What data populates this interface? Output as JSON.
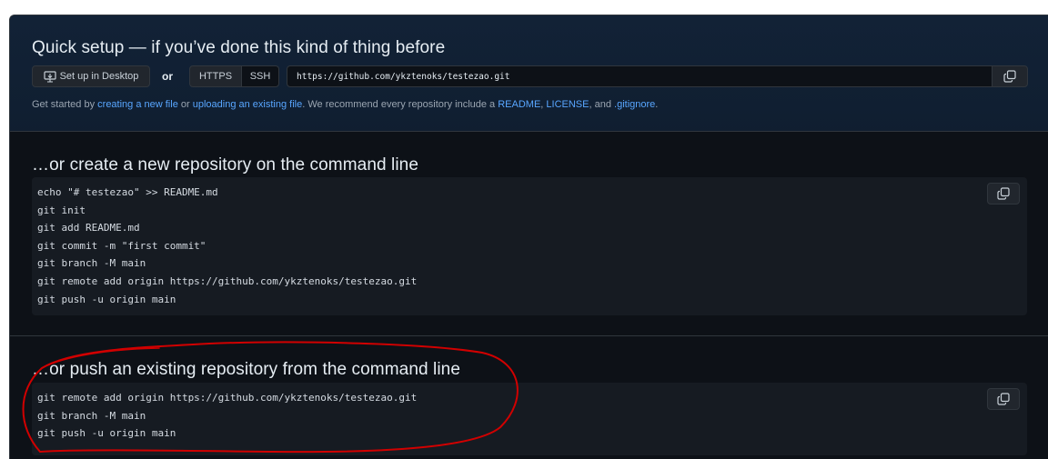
{
  "quick_setup": {
    "title": "Quick setup — if you’ve done this kind of thing before",
    "desktop_button_label": "Set up in Desktop",
    "or_label": "or",
    "https_label": "HTTPS",
    "ssh_label": "SSH",
    "repo_url": "https://github.com/ykztenoks/testezao.git",
    "get_started": {
      "prefix": "Get started by ",
      "link_new_file": "creating a new file",
      "middle": " or ",
      "link_upload": "uploading an existing file",
      "recommend": ". We recommend every repository include a ",
      "link_readme": "README",
      "sep1": ", ",
      "link_license": "LICENSE",
      "sep2": ", and ",
      "link_gitignore": ".gitignore",
      "suffix": "."
    }
  },
  "create_section": {
    "title": "…or create a new repository on the command line",
    "lines": [
      "echo \"# testezao\" >> README.md",
      "git init",
      "git add README.md",
      "git commit -m \"first commit\"",
      "git branch -M main",
      "git remote add origin https://github.com/ykztenoks/testezao.git",
      "git push -u origin main"
    ]
  },
  "push_section": {
    "title": "…or push an existing repository from the command line",
    "lines": [
      "git remote add origin https://github.com/ykztenoks/testezao.git",
      "git branch -M main",
      "git push -u origin main"
    ]
  },
  "icons": {
    "desktop": "desktop-download-icon",
    "copy": "copy-icon"
  },
  "colors": {
    "background": "#0d1117",
    "link": "#58a6ff",
    "annotation": "#d10000"
  }
}
